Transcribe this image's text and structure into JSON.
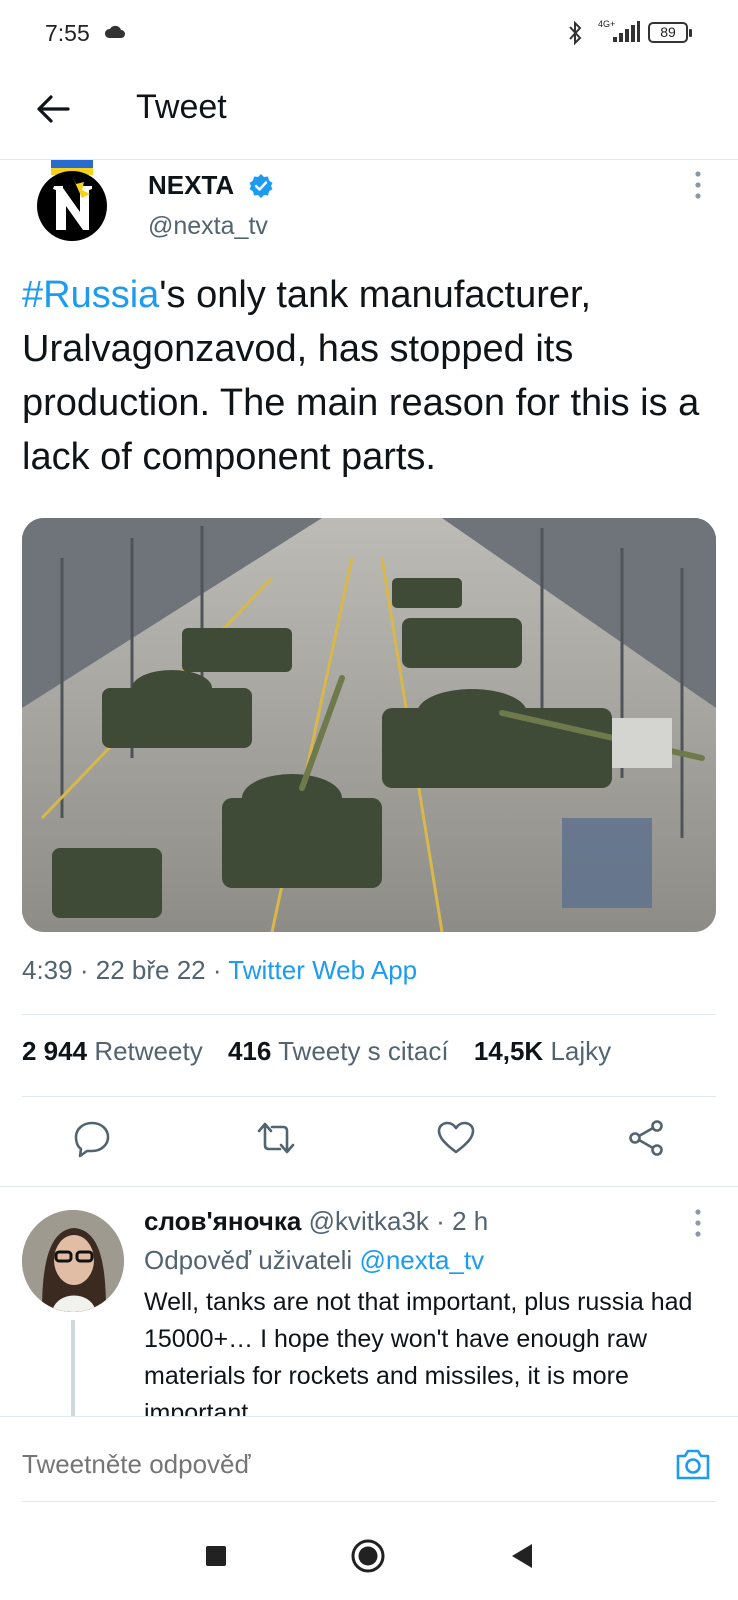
{
  "status_bar": {
    "time": "7:55",
    "network": "4G+",
    "battery": "89",
    "icons": [
      "cloud-icon",
      "bluetooth-icon",
      "signal-icon",
      "battery-icon"
    ]
  },
  "header": {
    "title": "Tweet"
  },
  "tweet": {
    "author_name": "NEXTA",
    "author_handle": "@nexta_tv",
    "text_hashtag": "#Russia",
    "text_rest": "'s only tank manufacturer, Uralvagonzavod, has stopped its production. The main reason for this is a lack of component parts.",
    "time": "4:39",
    "date": "22 bře 22",
    "separator": "·",
    "app": "Twitter Web App",
    "stats": {
      "retweets_count": "2 944",
      "retweets_label": "Retweety",
      "quotes_count": "416",
      "quotes_label": "Tweety s citací",
      "likes_count": "14,5K",
      "likes_label": "Lajky"
    }
  },
  "reply": {
    "author_name": "слов'яночка",
    "author_handle": "@kvitka3k",
    "time": "2 h",
    "separator": "·",
    "reply_prefix": "Odpověď uživateli",
    "reply_mention": "@nexta_tv",
    "text": "Well, tanks are not that important, plus russia had 15000+… I hope they won't have enough raw materials for rockets and missiles, it is more important"
  },
  "compose": {
    "placeholder": "Tweetněte odpověď"
  },
  "colors": {
    "accent": "#1d9bf0",
    "text": "#0f1419",
    "secondary": "#536471",
    "divider": "#e1e8ed"
  }
}
